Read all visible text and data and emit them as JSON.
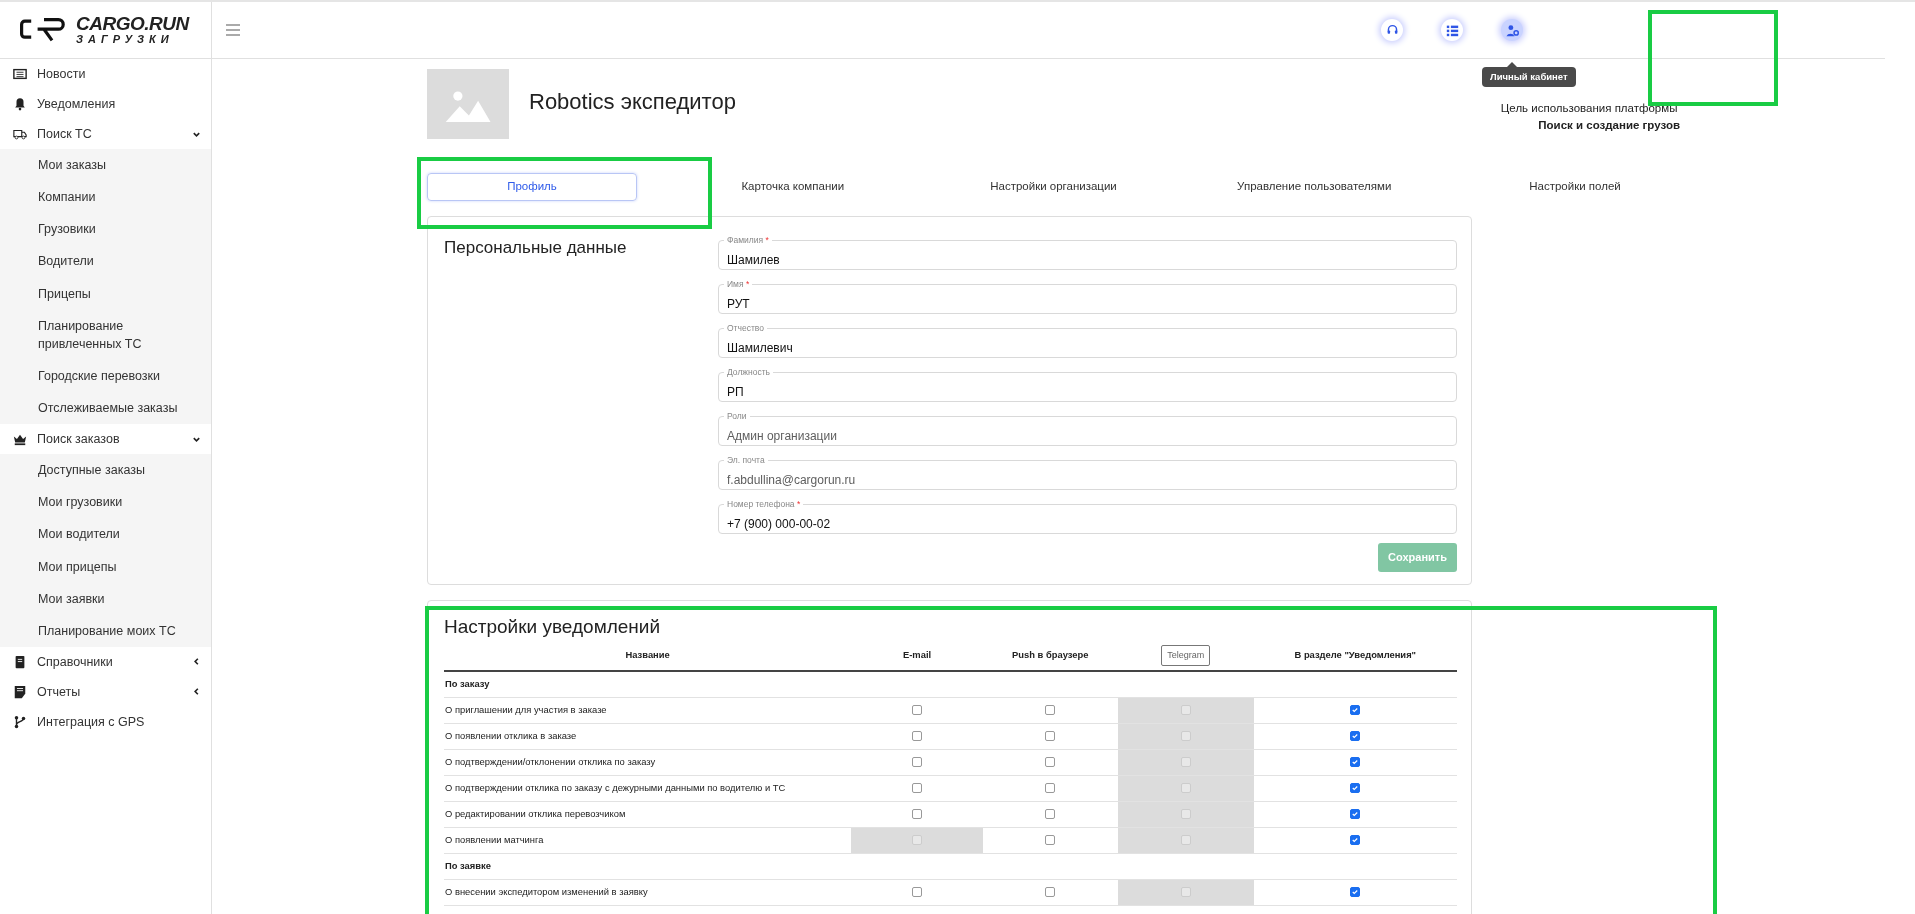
{
  "logo": {
    "name": "CARGO.RUN",
    "subtitle": "ЗАГРУЗКИ"
  },
  "sidebar": {
    "items": [
      {
        "label": "Новости"
      },
      {
        "label": "Уведомления"
      },
      {
        "label": "Поиск ТС",
        "expanded": true,
        "children": [
          {
            "label": "Мои заказы"
          },
          {
            "label": "Компании"
          },
          {
            "label": "Грузовики"
          },
          {
            "label": "Водители"
          },
          {
            "label": "Прицепы"
          },
          {
            "label": "Планирование привлеченных ТС"
          },
          {
            "label": "Городские перевозки"
          },
          {
            "label": "Отслеживаемые заказы"
          }
        ]
      },
      {
        "label": "Поиск заказов",
        "expanded": true,
        "children": [
          {
            "label": "Доступные заказы"
          },
          {
            "label": "Мои грузовики"
          },
          {
            "label": "Мои водители"
          },
          {
            "label": "Мои прицепы"
          },
          {
            "label": "Мои заявки"
          },
          {
            "label": "Планирование моих ТС"
          }
        ]
      },
      {
        "label": "Справочники",
        "expanded": false
      },
      {
        "label": "Отчеты",
        "expanded": false
      },
      {
        "label": "Интеграция с GPS"
      }
    ]
  },
  "header": {
    "buttons": [
      {
        "selected": false
      },
      {
        "selected": false
      },
      {
        "selected": true,
        "tooltip": "Личный кабинет"
      }
    ]
  },
  "profile": {
    "title": "Robotics экспедитор",
    "purpose_label": "Цель использования платформы",
    "purpose_value": "Поиск и создание грузов"
  },
  "tabs": [
    {
      "label": "Профиль",
      "selected": true
    },
    {
      "label": "Карточка компании",
      "selected": false
    },
    {
      "label": "Настройки организации",
      "selected": false
    },
    {
      "label": "Управление пользователями",
      "selected": false
    },
    {
      "label": "Настройки полей",
      "selected": false
    }
  ],
  "personal": {
    "title": "Персональные данные",
    "fields": [
      {
        "label": "Фамилия",
        "mark": "*",
        "value": "Шамилев",
        "disabled": false
      },
      {
        "label": "Имя",
        "mark": "*",
        "value": "РУТ",
        "disabled": false
      },
      {
        "label": "Отчество",
        "value": "Шамилевич",
        "disabled": false
      },
      {
        "label": "Должность",
        "value": "РП",
        "disabled": false
      },
      {
        "label": "Роли",
        "value": "Админ организации",
        "disabled": true
      },
      {
        "label": "Эл. почта",
        "value": "f.abdullina@cargorun.ru",
        "disabled": true
      },
      {
        "label": "Номер телефона",
        "mark": "*",
        "value": "+7 (900) 000-00-02",
        "disabled": false
      }
    ],
    "save_button": {
      "label": "Сохранить",
      "disabled": true
    }
  },
  "notifications": {
    "title": "Настройки уведомлений",
    "columns": [
      {
        "label": "Название",
        "kind": "text"
      },
      {
        "label": "E-mail",
        "kind": "text"
      },
      {
        "label": "Push в браузере",
        "kind": "text"
      },
      {
        "label": "Telegram",
        "kind": "button"
      },
      {
        "label": "В разделе \"Уведомления\"",
        "kind": "text"
      }
    ],
    "rows": [
      {
        "kind": "group",
        "label": "По заказу"
      },
      {
        "kind": "item",
        "label": "О приглашении для участия в заказе",
        "cells": [
          {
            "checked": false,
            "disabled": false
          },
          {
            "checked": false,
            "disabled": false
          },
          {
            "checked": false,
            "disabled": true
          },
          {
            "checked": true,
            "disabled": false
          }
        ]
      },
      {
        "kind": "item",
        "label": "О появлении отклика в заказе",
        "cells": [
          {
            "checked": false,
            "disabled": false
          },
          {
            "checked": false,
            "disabled": false
          },
          {
            "checked": false,
            "disabled": true
          },
          {
            "checked": true,
            "disabled": false
          }
        ]
      },
      {
        "kind": "item",
        "label": "О подтверждении/отклонении отклика по заказу",
        "cells": [
          {
            "checked": false,
            "disabled": false
          },
          {
            "checked": false,
            "disabled": false
          },
          {
            "checked": false,
            "disabled": true
          },
          {
            "checked": true,
            "disabled": false
          }
        ]
      },
      {
        "kind": "item",
        "label": "О подтверждении отклика по заказу с дежурными данными по водителю и ТС",
        "cells": [
          {
            "checked": false,
            "disabled": false
          },
          {
            "checked": false,
            "disabled": false
          },
          {
            "checked": false,
            "disabled": true
          },
          {
            "checked": true,
            "disabled": false
          }
        ]
      },
      {
        "kind": "item",
        "label": "О редактировании отклика перевозчиком",
        "cells": [
          {
            "checked": false,
            "disabled": false
          },
          {
            "checked": false,
            "disabled": false
          },
          {
            "checked": false,
            "disabled": true
          },
          {
            "checked": true,
            "disabled": false
          }
        ]
      },
      {
        "kind": "item",
        "label": "О появлении матчинга",
        "cells": [
          {
            "checked": false,
            "disabled": true
          },
          {
            "checked": false,
            "disabled": false
          },
          {
            "checked": false,
            "disabled": true
          },
          {
            "checked": true,
            "disabled": false
          }
        ]
      },
      {
        "kind": "group",
        "label": "По заявке"
      },
      {
        "kind": "item",
        "label": "О внесении экспедитором изменений в заявку",
        "cells": [
          {
            "checked": false,
            "disabled": false
          },
          {
            "checked": false,
            "disabled": false
          },
          {
            "checked": false,
            "disabled": true
          },
          {
            "checked": true,
            "disabled": false
          }
        ]
      }
    ]
  }
}
